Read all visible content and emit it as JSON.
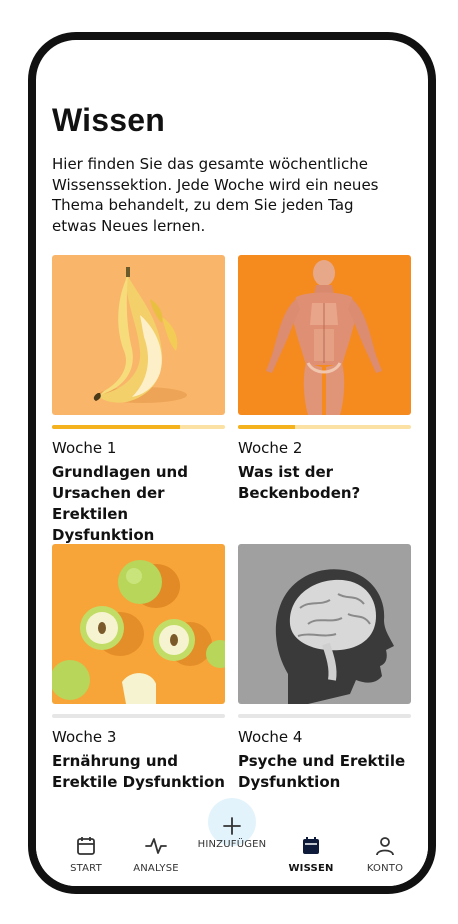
{
  "page": {
    "title": "Wissen",
    "intro": "Hier finden Sie das gesamte wöchentliche Wissenssektion. Jede Woche wird ein neues Thema behandelt, zu dem Sie jeden Tag etwas Neues lernen."
  },
  "cards": [
    {
      "week": "Woche 1",
      "title": "Grundlagen und Ursachen der Erektilen Dysfunktion",
      "progress": 0.74,
      "image": "banana"
    },
    {
      "week": "Woche 2",
      "title": "Was ist der Beckenboden?",
      "progress": 0.33,
      "image": "anatomy-muscles"
    },
    {
      "week": "Woche 3",
      "title": "Ernährung und Erektile Dysfunktion",
      "progress": 0,
      "image": "apples"
    },
    {
      "week": "Woche 4",
      "title": "Psyche und Erektile Dysfunktion",
      "progress": 0,
      "image": "brain-xray"
    }
  ],
  "nav": [
    {
      "label": "START",
      "icon": "calendar-icon",
      "active": false
    },
    {
      "label": "ANALYSE",
      "icon": "activity-icon",
      "active": false
    },
    {
      "label": "HINZUFÜGEN",
      "icon": "plus-icon",
      "active": false
    },
    {
      "label": "WISSEN",
      "icon": "calendar-filled-icon",
      "active": true
    },
    {
      "label": "KONTO",
      "icon": "user-icon",
      "active": false
    }
  ],
  "colors": {
    "accent": "#f4b31e",
    "accent_light": "#fbe1a3",
    "track": "#e6e6e6",
    "add_bg": "#e3f3fb"
  }
}
